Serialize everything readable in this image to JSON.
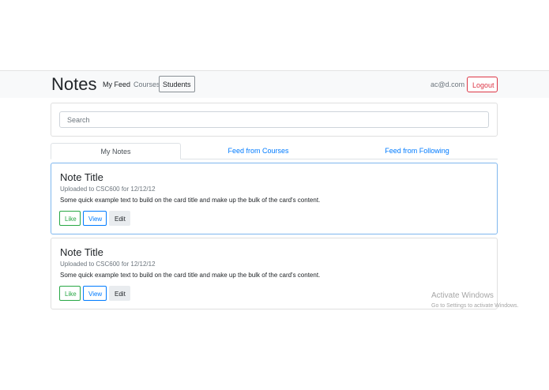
{
  "navbar": {
    "brand": "Notes",
    "links": [
      "My Feed",
      "Courses",
      "Students"
    ],
    "user_email": "ac@d.com",
    "logout_label": "Logout"
  },
  "search": {
    "placeholder": "Search",
    "value": ""
  },
  "tabs": [
    {
      "label": "My Notes",
      "active": true
    },
    {
      "label": "Feed from Courses",
      "active": false
    },
    {
      "label": "Feed from Following",
      "active": false
    }
  ],
  "notes": [
    {
      "title": "Note Title",
      "subtitle": "Uploaded to CSC600 for 12/12/12",
      "text": "Some quick example text to build on the card title and make up the bulk of the card's content.",
      "like_label": "Like",
      "view_label": "View",
      "edit_label": "Edit"
    },
    {
      "title": "Note Title",
      "subtitle": "Uploaded to CSC600 for 12/12/12",
      "text": "Some quick example text to build on the card title and make up the bulk of the card's content.",
      "like_label": "Like",
      "view_label": "View",
      "edit_label": "Edit"
    }
  ],
  "watermark": {
    "title": "Activate Windows",
    "subtitle": "Go to Settings to activate Windows."
  },
  "colors": {
    "primary": "#007bff",
    "success": "#28a745",
    "danger": "#dc3545",
    "navbar_bg": "#f8f9fa"
  }
}
